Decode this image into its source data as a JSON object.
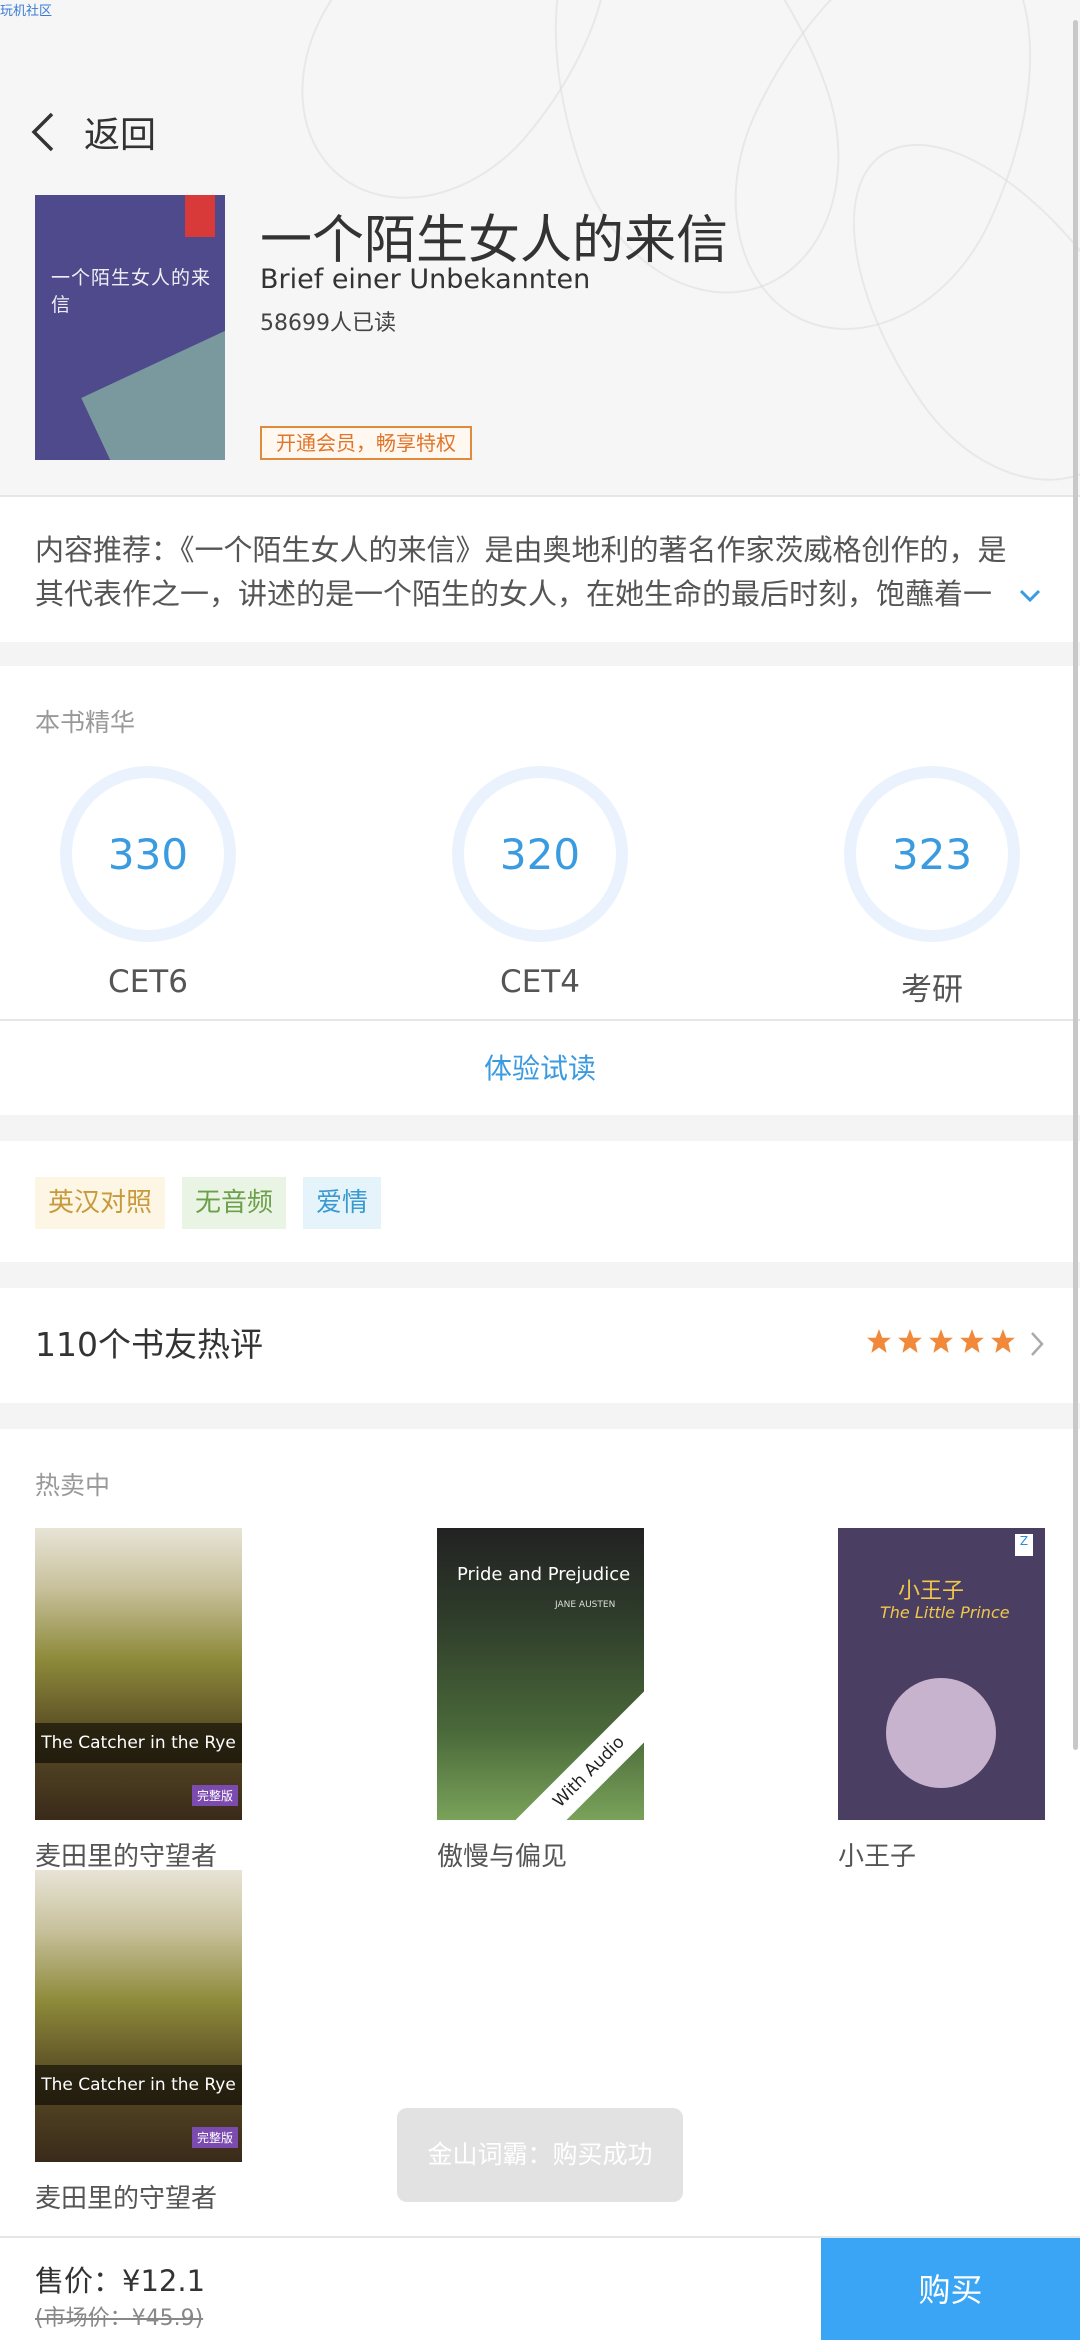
{
  "watermark": "玩机社区",
  "header": {
    "back_label": "返回"
  },
  "book": {
    "cover_title": "一个陌生女人的来信",
    "title": "一个陌生女人的来信",
    "subtitle": "Brief einer Unbekannten",
    "readers": "58699人已读",
    "vip_label": "开通会员，畅享特权"
  },
  "summary": "内容推荐：《一个陌生女人的来信》是由奥地利的著名作家茨威格创作的，是其代表作之一，讲述的是一个陌生的女人，在她生命的最后时刻，饱蘸着一",
  "essence": {
    "label": "本书精华",
    "items": [
      {
        "value": "330",
        "label": "CET6"
      },
      {
        "value": "320",
        "label": "CET4"
      },
      {
        "value": "323",
        "label": "考研"
      }
    ],
    "trial_label": "体验试读"
  },
  "tags": [
    "英汉对照",
    "无音频",
    "爱情"
  ],
  "reviews": {
    "label": "110个书友热评",
    "rating": 5
  },
  "hot": {
    "label": "热卖中",
    "books": [
      {
        "name": "麦田里的守望者",
        "cover_text": "The Catcher in the Rye",
        "badge": "完整版"
      },
      {
        "name": "傲慢与偏见",
        "cover_text": "Pride and Prejudice",
        "cover_author": "JANE AUSTEN",
        "ribbon": "With Audio"
      },
      {
        "name": "小王子",
        "cover_text": "小王子",
        "cover_text2": "The Little Prince",
        "logo": "Z"
      },
      {
        "name": "麦田里的守望者",
        "cover_text": "The Catcher in the Rye",
        "badge": "完整版"
      }
    ]
  },
  "toast": "金山词霸：购买成功",
  "footer": {
    "price": "售价：¥12.1",
    "original_price": "(市场价：¥45.9)",
    "buy_label": "购买"
  },
  "colors": {
    "accent": "#3aa5f4",
    "ring": "#3a9be0",
    "star": "#f08a3a",
    "vip": "#e0762b"
  }
}
